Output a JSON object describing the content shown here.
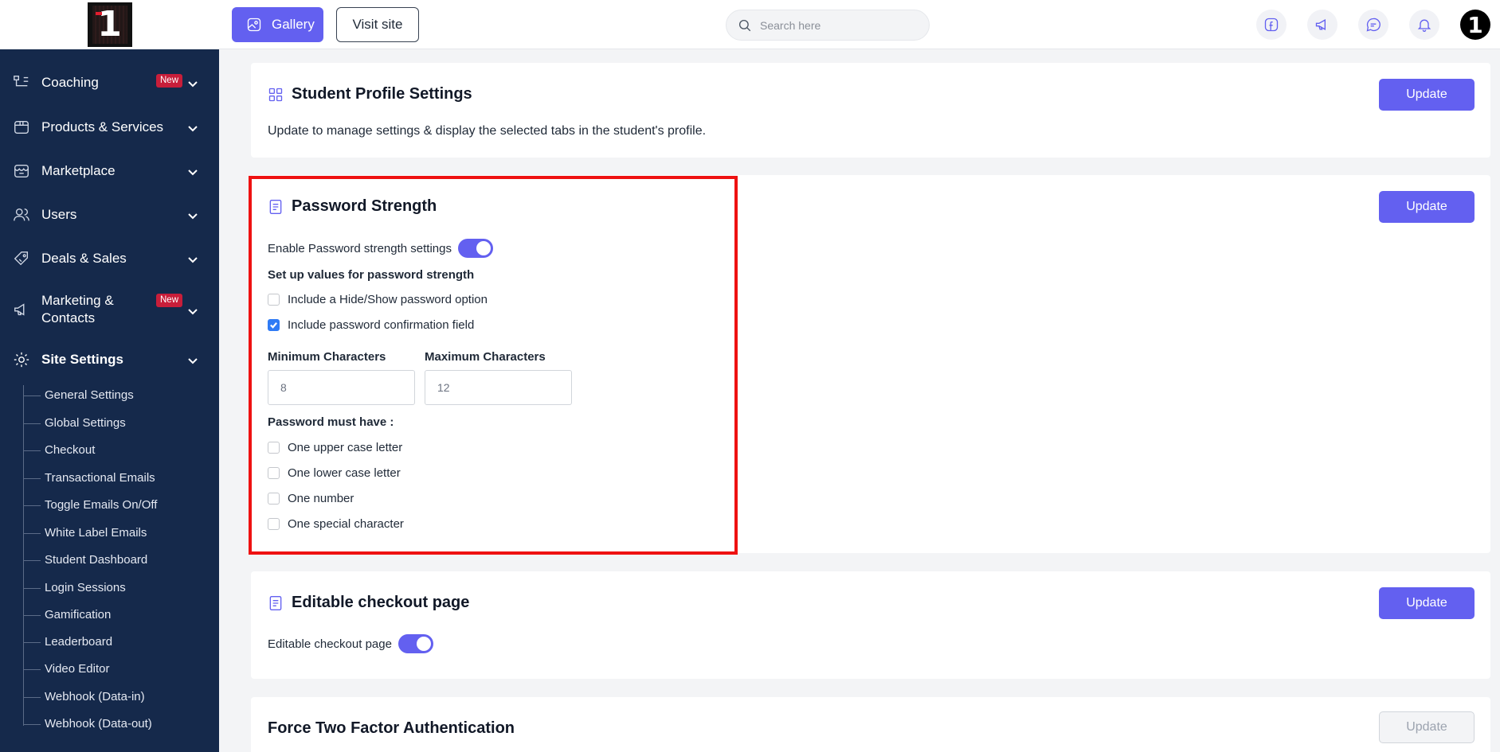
{
  "sidebar": {
    "logo_text": "1",
    "items": [
      {
        "label": "Coaching",
        "badge": "New"
      },
      {
        "label": "Products & Services"
      },
      {
        "label": "Marketplace"
      },
      {
        "label": "Users"
      },
      {
        "label": "Deals & Sales"
      },
      {
        "label": "Marketing & Contacts",
        "label_line1": "Marketing &",
        "label_line2": "Contacts",
        "badge": "New"
      },
      {
        "label": "Site Settings"
      }
    ],
    "sub_items": [
      "General Settings",
      "Global Settings",
      "Checkout",
      "Transactional Emails",
      "Toggle Emails On/Off",
      "White Label Emails",
      "Student Dashboard",
      "Login Sessions",
      "Gamification",
      "Leaderboard",
      "Video Editor",
      "Webhook (Data-in)",
      "Webhook (Data-out)"
    ]
  },
  "topbar": {
    "gallery_label": "Gallery",
    "visit_label": "Visit site",
    "search_placeholder": "Search here",
    "avatar_text": "1"
  },
  "cards": {
    "student_profile": {
      "title": "Student Profile Settings",
      "update_label": "Update",
      "description": "Update to manage settings & display the selected tabs in the student's profile."
    },
    "password_strength": {
      "title": "Password Strength",
      "update_label": "Update",
      "enable_label": "Enable Password strength settings",
      "enable_on": true,
      "setup_heading": "Set up values for password strength",
      "hide_show_label": "Include a Hide/Show password option",
      "hide_show_checked": false,
      "confirm_label": "Include password confirmation field",
      "confirm_checked": true,
      "min_label": "Minimum Characters",
      "min_value": "8",
      "max_label": "Maximum Characters",
      "max_value": "12",
      "must_have_heading": "Password must have :",
      "rules": [
        {
          "label": "One upper case letter",
          "checked": false
        },
        {
          "label": "One lower case letter",
          "checked": false
        },
        {
          "label": "One number",
          "checked": false
        },
        {
          "label": "One special character",
          "checked": false
        }
      ]
    },
    "editable_checkout": {
      "title": "Editable checkout page",
      "update_label": "Update",
      "toggle_label": "Editable checkout page",
      "toggle_on": true
    },
    "two_factor": {
      "title": "Force Two Factor Authentication",
      "update_label": "Update"
    }
  },
  "colors": {
    "sidebar_bg": "#15294b",
    "accent": "#6360f0",
    "badge": "#c81e3a",
    "highlight": "#ee1111",
    "checkbox_checked": "#2f7bf5"
  }
}
